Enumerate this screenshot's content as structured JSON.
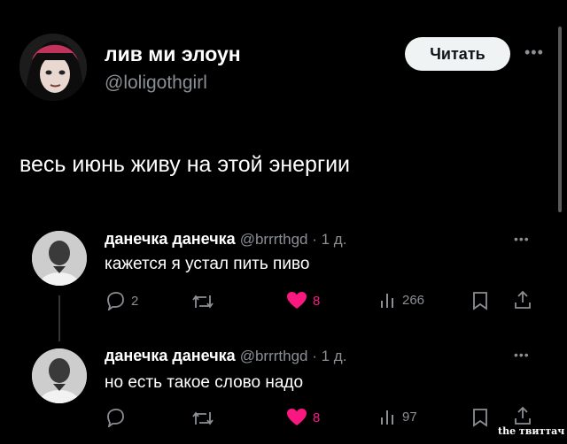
{
  "author": {
    "name": "лив ми элоун",
    "handle": "@loligothgirl",
    "follow_label": "Читать"
  },
  "tweet": {
    "text": "весь июнь живу на этой энергии"
  },
  "replies": [
    {
      "name": "данечка данечка",
      "meta": "@brrrthgd · 1 д.",
      "text": "кажется я устал пить пиво",
      "replies_count": "2",
      "likes": "8",
      "views": "266"
    },
    {
      "name": "данечка данечка",
      "meta": "@brrrthgd · 1 д.",
      "text": "но есть такое слово надо",
      "replies_count": "",
      "likes": "8",
      "views": "97"
    }
  ],
  "watermark": "the твиттач",
  "colors": {
    "background": "#000000",
    "secondary_text": "#8b8f94",
    "like_pink": "#f91880",
    "button_bg": "#eff3f4"
  },
  "icons": [
    "reply-icon",
    "retweet-icon",
    "heart-icon",
    "views-icon",
    "bookmark-icon",
    "share-icon",
    "more-icon"
  ]
}
